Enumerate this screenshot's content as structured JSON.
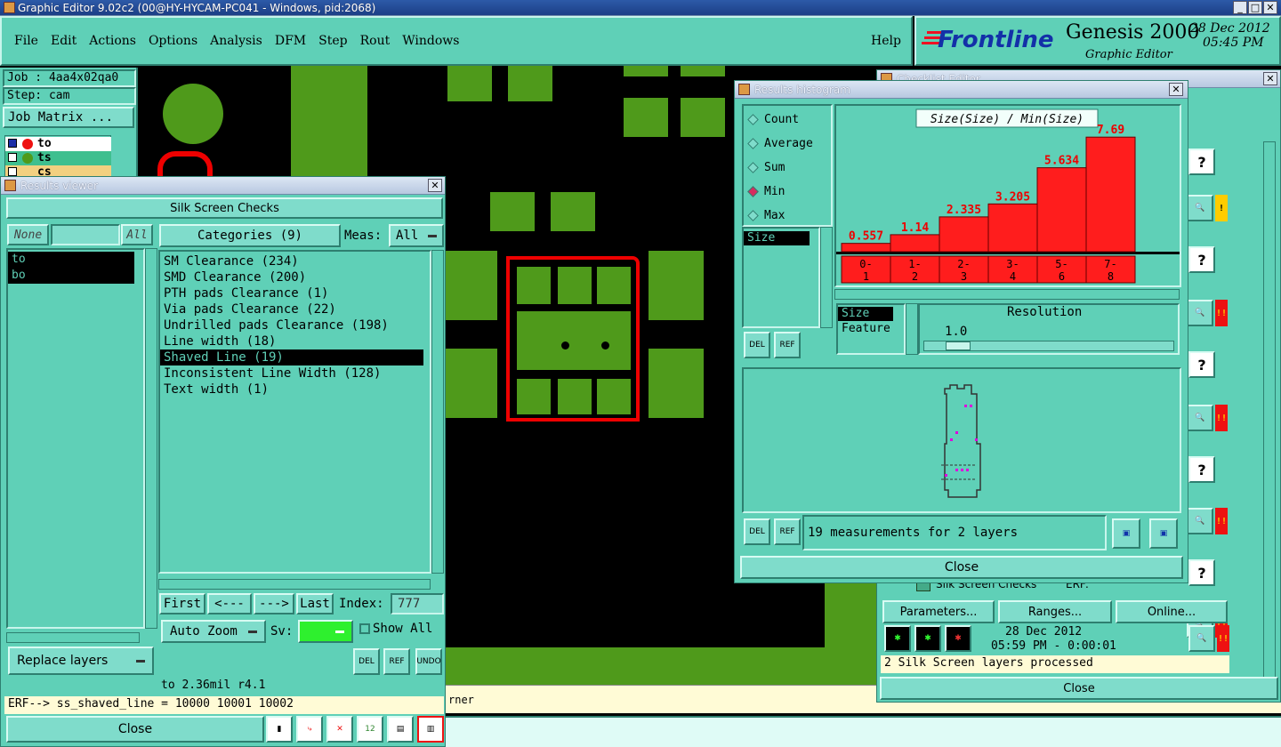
{
  "app": {
    "title": "Graphic Editor 9.02c2 (00@HY-HYCAM-PC041 - Windows, pid:2068)",
    "menu": [
      "File",
      "Edit",
      "Actions",
      "Options",
      "Analysis",
      "DFM",
      "Step",
      "Rout",
      "Windows"
    ],
    "help": "Help",
    "brand": "Frontline",
    "product": "Genesis 2000",
    "product_sub": "Graphic Editor",
    "date": "28 Dec 2012",
    "time": "05:45 PM"
  },
  "job_panel": {
    "job": "Job : 4aa4x02qa0",
    "step": "Step: cam",
    "matrix_button": "Job Matrix ...",
    "layers": [
      "to",
      "ts",
      "cs"
    ]
  },
  "results_viewer": {
    "title": "Results viewer",
    "header": "Silk Screen Checks",
    "none_btn": "None",
    "all_btn": "All",
    "layers": [
      "to",
      "bo"
    ],
    "categories_btn": "Categories (9)",
    "meas_label": "Meas:",
    "meas_value": "All",
    "categories": [
      "SM Clearance (234)",
      "SMD Clearance (200)",
      "PTH pads Clearance (1)",
      "Via pads Clearance (22)",
      "Undrilled pads Clearance (198)",
      "Line width (18)",
      "Shaved Line (19)",
      "Inconsistent Line Width (128)",
      "Text width (1)"
    ],
    "selected_category": 6,
    "nav": {
      "first": "First",
      "prev": "<---",
      "next": "--->",
      "last": "Last",
      "index_label": "Index:",
      "index_value": "777"
    },
    "auto_zoom": "Auto Zoom",
    "sv_label": "Sv:",
    "show_all": "Show All",
    "replace_layers": "Replace layers",
    "status": "to 2.36mil  r4.1",
    "erf": "ERF--> ss_shaved_line = 10000 10001 10002",
    "close": "Close",
    "icon_del": "DEL",
    "icon_ref": "REF",
    "icon_undo": "UNDO"
  },
  "histogram": {
    "title": "Results histogram",
    "modes": [
      "Count",
      "Average",
      "Sum",
      "Min",
      "Max"
    ],
    "selected_mode": 3,
    "attr_list": [
      "Size"
    ],
    "chart_title": "Size(Size) / Min(Size)",
    "resolution_label": "Resolution",
    "resolution_value": "1.0",
    "sort_list": [
      "Size",
      "Feature"
    ],
    "measurements": "19 measurements for 2 layers",
    "close": "Close",
    "icon_del": "DEL",
    "icon_ref": "REF"
  },
  "chart_data": {
    "type": "bar",
    "title": "Size(Size) / Min(Size)",
    "categories": [
      "0-1",
      "1-2",
      "2-3",
      "3-4",
      "5-6",
      "7-8"
    ],
    "values": [
      0.557,
      1.14,
      2.335,
      3.205,
      5.634,
      7.69
    ],
    "value_labels": [
      "0.557",
      "1.14",
      "2.335",
      "3.205",
      "5.634",
      "7.69"
    ],
    "category_labels": [
      [
        "0-",
        "1"
      ],
      [
        "1-",
        "2"
      ],
      [
        "2-",
        "3"
      ],
      [
        "3-",
        "4"
      ],
      [
        "5-",
        "6"
      ],
      [
        "7-",
        "8"
      ]
    ],
    "ylim": [
      0,
      8
    ],
    "bar_color": "#ff1d1d"
  },
  "checklist": {
    "title": "Checklist Editor",
    "check_name": "Silk Screen Checks",
    "erf_label": "ERF:",
    "parameters": "Parameters...",
    "ranges": "Ranges...",
    "online": "Online...",
    "date": "28 Dec 2012",
    "time": "05:59 PM - 0:00:01",
    "status": "2 Silk Screen layers processed",
    "close": "Close",
    "help_glyph": "?",
    "warn_glyph": "!",
    "err_glyph": "!!"
  },
  "bottom": {
    "corner_text": "rner"
  },
  "colors": {
    "teal": "#5fd0b7",
    "pcb_green": "#4f9a1b",
    "bar_red": "#ff1d1d"
  }
}
